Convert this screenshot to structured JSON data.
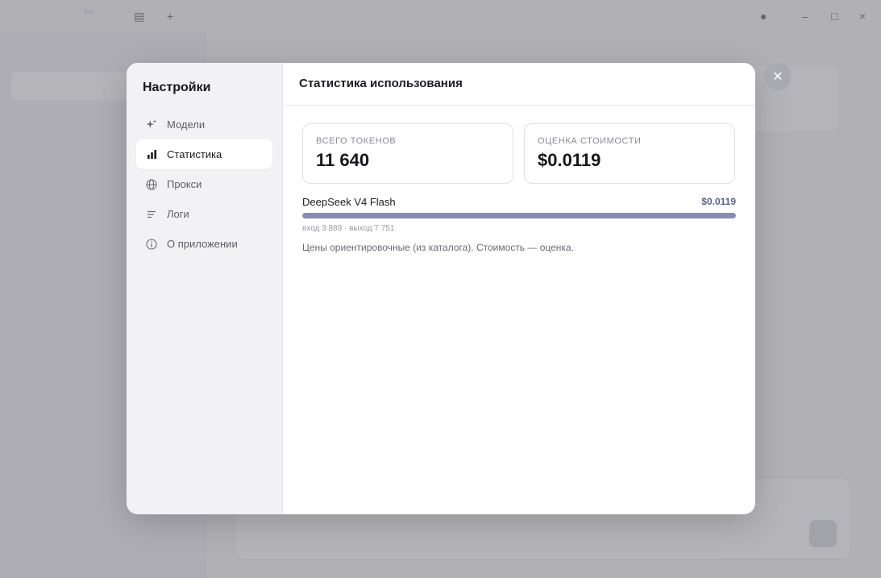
{
  "modal": {
    "sidebar_title": "Настройки",
    "nav": [
      {
        "label": "Модели",
        "icon": "sparkle-icon"
      },
      {
        "label": "Статистика",
        "icon": "bar-chart-icon",
        "active": true
      },
      {
        "label": "Прокси",
        "icon": "globe-icon"
      },
      {
        "label": "Логи",
        "icon": "list-lines-icon"
      },
      {
        "label": "О приложении",
        "icon": "info-icon"
      }
    ],
    "header_title": "Статистика использования",
    "cards": [
      {
        "label": "ВСЕГО ТОКЕНОВ",
        "value": "11 640"
      },
      {
        "label": "ОЦЕНКА СТОИМОСТИ",
        "value": "$0.0119"
      }
    ],
    "model_usage": {
      "name": "DeepSeek V4 Flash",
      "cost": "$0.0119",
      "share": 1.0,
      "io_text": "вход 3 889 · выход 7 751"
    },
    "note": "Цены ориентировочные (из каталога). Стоимость — оценка.",
    "close_icon": "close-icon"
  },
  "colors": {
    "accent": "#858cb8",
    "cost_text": "#5a6099",
    "overlay": "#9c9ca3"
  }
}
